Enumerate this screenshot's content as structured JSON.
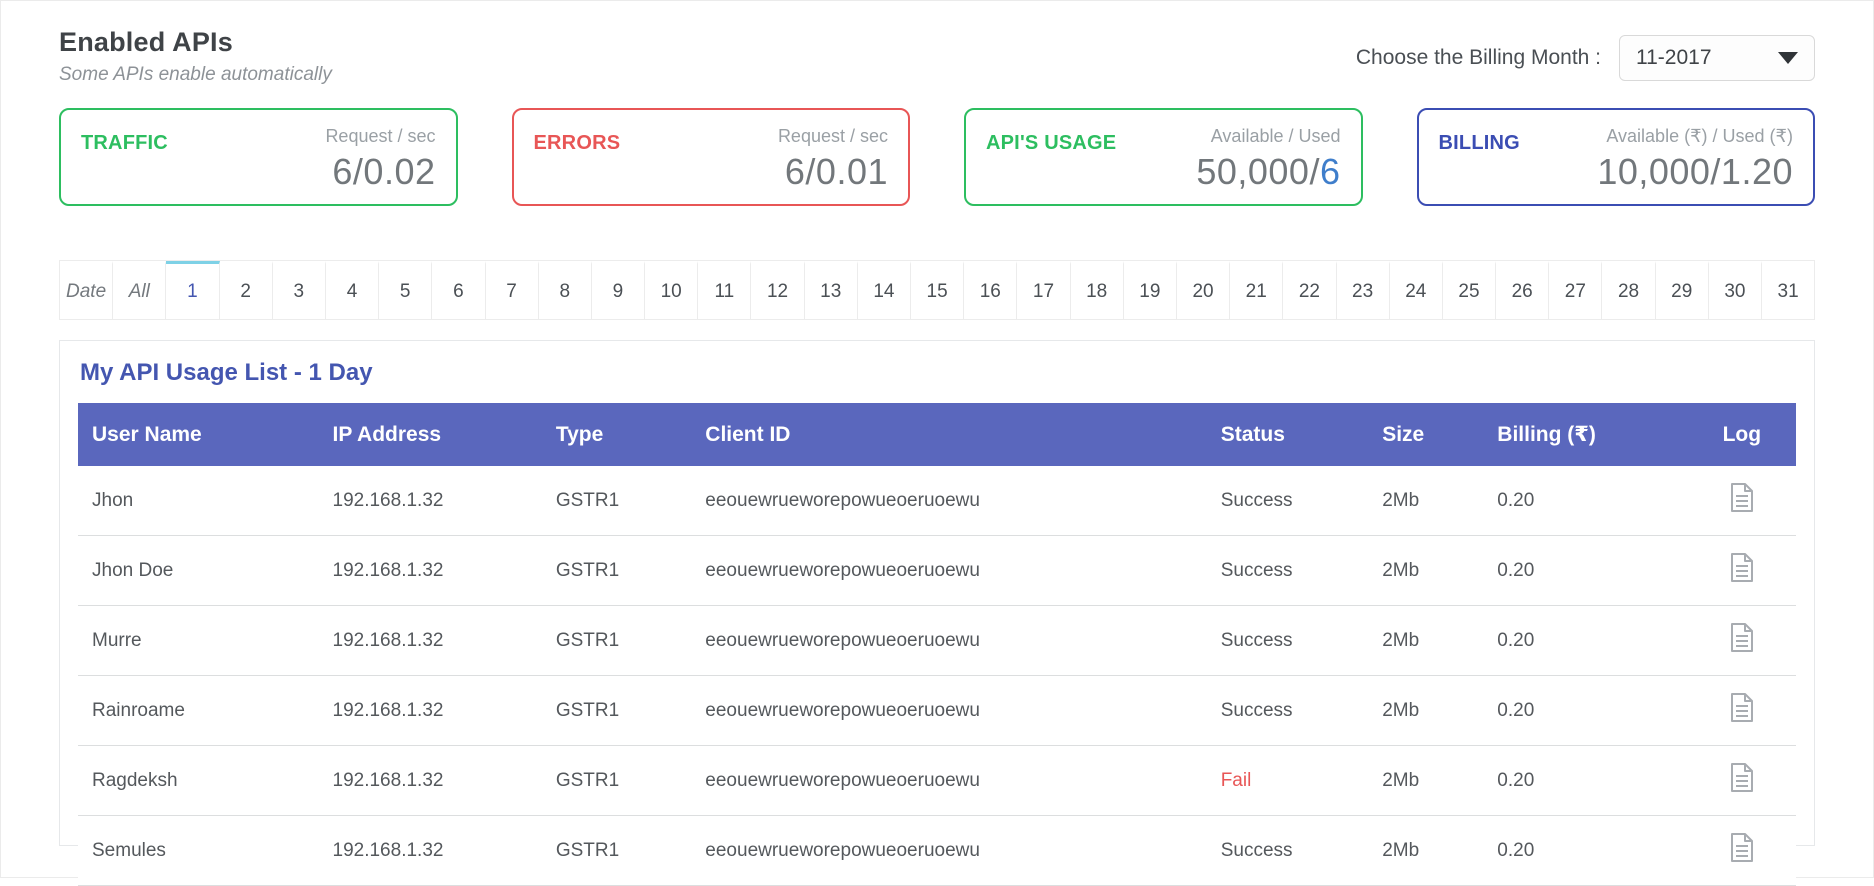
{
  "header": {
    "title": "Enabled APIs",
    "subtitle": "Some APIs enable automatically",
    "billing_month_label": "Choose the Billing Month :",
    "billing_month_value": "11-2017"
  },
  "cards": [
    {
      "id": "traffic",
      "label": "TRAFFIC",
      "unit": "Request / sec",
      "color": "#2dbe60",
      "value_parts": [
        {
          "text": "6/0.02",
          "accent": false
        }
      ]
    },
    {
      "id": "errors",
      "label": "ERRORS",
      "unit": "Request / sec",
      "color": "#e85656",
      "value_parts": [
        {
          "text": "6/0.01",
          "accent": false
        }
      ]
    },
    {
      "id": "apis-usage",
      "label": "API'S USAGE",
      "unit": "Available / Used",
      "color": "#2dbe60",
      "value_parts": [
        {
          "text": "50,000/",
          "accent": false
        },
        {
          "text": "6",
          "accent": true
        }
      ]
    },
    {
      "id": "billing",
      "label": "BILLING",
      "unit": "Available (₹) / Used (₹)",
      "color": "#3b4db3",
      "value_parts": [
        {
          "text": "10,000/1.20",
          "accent": false
        }
      ]
    }
  ],
  "date_tabs": {
    "items": [
      "Date",
      "All",
      "1",
      "2",
      "3",
      "4",
      "5",
      "6",
      "7",
      "8",
      "9",
      "10",
      "11",
      "12",
      "13",
      "14",
      "15",
      "16",
      "17",
      "18",
      "19",
      "20",
      "21",
      "22",
      "23",
      "24",
      "25",
      "26",
      "27",
      "28",
      "29",
      "30",
      "31"
    ],
    "italic_labels": [
      "Date",
      "All"
    ],
    "active": "1"
  },
  "usage": {
    "heading": "My API Usage List - 1 Day",
    "columns": [
      "User Name",
      "IP Address",
      "Type",
      "Client ID",
      "Status",
      "Size",
      "Billing (₹)",
      "Log"
    ],
    "rows": [
      {
        "user": "Jhon",
        "ip": "192.168.1.32",
        "type": "GSTR1",
        "client_id": "eeouewrueworepowueoeruoewu",
        "status": "Success",
        "size": "2Mb",
        "billing": "0.20"
      },
      {
        "user": "Jhon Doe",
        "ip": "192.168.1.32",
        "type": "GSTR1",
        "client_id": "eeouewrueworepowueoeruoewu",
        "status": "Success",
        "size": "2Mb",
        "billing": "0.20"
      },
      {
        "user": "Murre",
        "ip": "192.168.1.32",
        "type": "GSTR1",
        "client_id": "eeouewrueworepowueoeruoewu",
        "status": "Success",
        "size": "2Mb",
        "billing": "0.20"
      },
      {
        "user": "Rainroame",
        "ip": "192.168.1.32",
        "type": "GSTR1",
        "client_id": "eeouewrueworepowueoeruoewu",
        "status": "Success",
        "size": "2Mb",
        "billing": "0.20"
      },
      {
        "user": "Ragdeksh",
        "ip": "192.168.1.32",
        "type": "GSTR1",
        "client_id": "eeouewrueworepowueoeruoewu",
        "status": "Fail",
        "size": "2Mb",
        "billing": "0.20"
      },
      {
        "user": "Semules",
        "ip": "192.168.1.32",
        "type": "GSTR1",
        "client_id": "eeouewrueworepowueoeruoewu",
        "status": "Success",
        "size": "2Mb",
        "billing": "0.20"
      }
    ]
  },
  "colors": {
    "green": "#2dbe60",
    "red": "#e85656",
    "blue": "#3b4db3",
    "accent_blue": "#3f7ecb",
    "teal": "#7ed1e6",
    "table_header_bg": "#5a67bd",
    "heading_blue": "#4456b0",
    "fail": "#e85656"
  }
}
